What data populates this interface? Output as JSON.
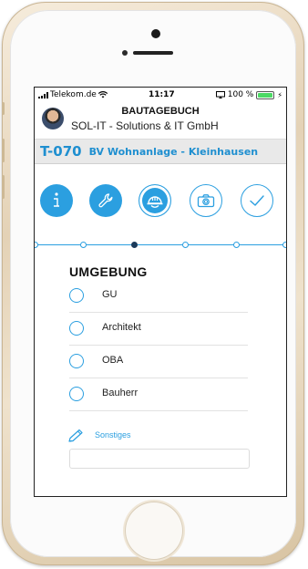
{
  "status_bar": {
    "carrier": "Telekom.de",
    "time": "11:17",
    "battery": "100 %"
  },
  "header": {
    "title": "BAUTAGEBUCH",
    "company": "SOL-IT - Solutions & IT GmbH"
  },
  "project": {
    "code": "T-070",
    "name": "BV Wohnanlage - Kleinhausen"
  },
  "steps": [
    {
      "icon": "info-icon",
      "state": "done"
    },
    {
      "icon": "wrench-icon",
      "state": "done"
    },
    {
      "icon": "helmet-icon",
      "state": "current"
    },
    {
      "icon": "camera-icon",
      "state": "pending"
    },
    {
      "icon": "checkmark-icon",
      "state": "pending"
    }
  ],
  "section": {
    "title": "UMGEBUNG",
    "options": [
      {
        "label": "GU",
        "selected": false
      },
      {
        "label": "Architekt",
        "selected": false
      },
      {
        "label": "OBA",
        "selected": false
      },
      {
        "label": "Bauherr",
        "selected": false
      }
    ],
    "other_label": "Sonstiges",
    "other_value": ""
  },
  "colors": {
    "accent": "#2b9fe0",
    "project_text": "#1f8fd0",
    "phone_frame": "#e8d9bf"
  }
}
